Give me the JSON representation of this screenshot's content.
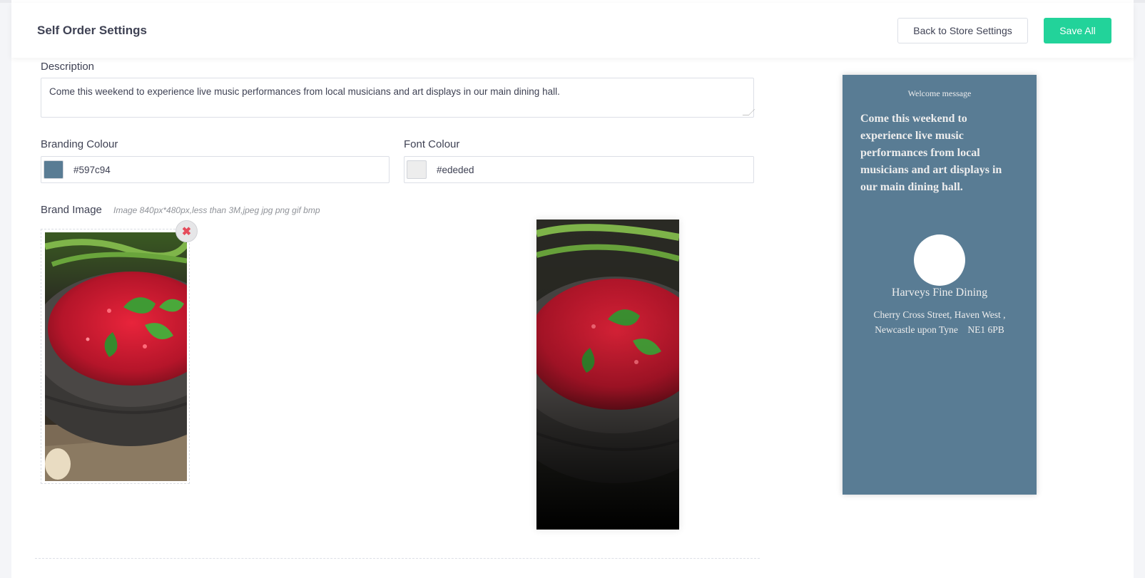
{
  "header": {
    "title": "Self Order Settings",
    "back_label": "Back to Store Settings",
    "save_label": "Save All"
  },
  "form": {
    "description_label": "Description",
    "description_value": "Come this weekend to experience live music performances from local musicians and art displays in our main dining hall.",
    "branding_colour_label": "Branding Colour",
    "branding_colour_value": "#597c94",
    "font_colour_label": "Font Colour",
    "font_colour_value": "#ededed",
    "brand_image_label": "Brand Image",
    "brand_image_hint": "Image 840px*480px,less than 3M,jpeg jpg png gif bmp"
  },
  "icons": {
    "remove": "close-icon"
  },
  "preview": {
    "welcome_title": "Welcome message",
    "description": "Come this weekend to experience live music performances from local musicians and art displays in our main dining hall.",
    "store_name": "Harveys Fine Dining",
    "address_line1": "Cherry Cross Street, Haven West ,",
    "address_line2": "Newcastle upon Tyne    NE1 6PB"
  },
  "colors": {
    "accent": "#22d39a",
    "branding": "#597c94",
    "font": "#ededed"
  }
}
